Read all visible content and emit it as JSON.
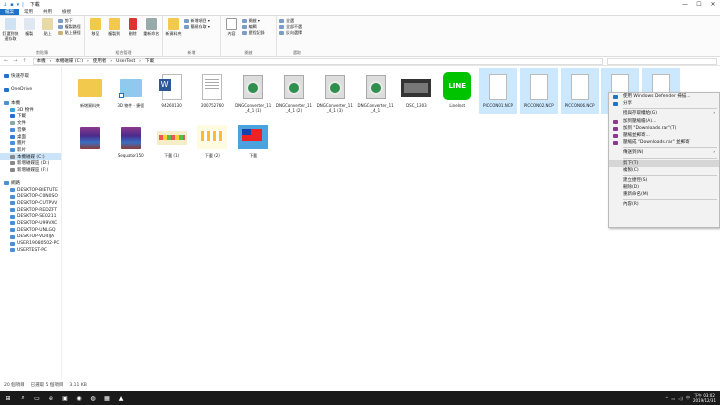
{
  "title": {
    "quick_icons": [
      "↓",
      "▪",
      "▾",
      "|"
    ],
    "path_label": "下載",
    "min": "—",
    "max": "☐",
    "close": "✕"
  },
  "tabs": [
    "檔案",
    "常用",
    "共用",
    "檢視"
  ],
  "ribbon": {
    "clipboard": {
      "label": "剪貼簿",
      "pin": "釘選到快速存取",
      "copy": "複製",
      "paste": "貼上",
      "cut": "剪下",
      "copy_path": "複製路徑",
      "paste_shortcut": "貼上捷徑"
    },
    "organize": {
      "label": "組合管理",
      "move_to": "移至",
      "copy_to": "複製到",
      "delete": "刪除",
      "rename": "重新命名"
    },
    "new": {
      "label": "新增",
      "new_folder": "新資料夾",
      "new_item": "新增項目 ▾",
      "easy_access": "簡易存取 ▾"
    },
    "open": {
      "label": "開啟",
      "properties": "內容",
      "open": "開啟 ▾",
      "edit": "編輯",
      "history": "歷程記錄"
    },
    "select": {
      "label": "選取",
      "select_all": "全選",
      "select_none": "全部不選",
      "invert": "反向選擇"
    }
  },
  "address": {
    "back": "←",
    "forward": "→",
    "up": "↑",
    "crumbs": [
      "本機",
      "›",
      "本機磁碟 (C:)",
      "›",
      "使用者",
      "›",
      "UserTest",
      "›",
      "下載"
    ]
  },
  "nav": [
    {
      "label": "快速存取",
      "color": "#1e73c8"
    },
    {
      "label": "",
      "color": ""
    },
    {
      "label": "OneDrive",
      "color": "#1e73c8"
    },
    {
      "label": "",
      "color": ""
    },
    {
      "label": "本機",
      "color": "#4a90d9"
    },
    {
      "label": "3D 物件",
      "color": "#3aa0e0"
    },
    {
      "label": "下載",
      "color": "#1e73c8"
    },
    {
      "label": "文件",
      "color": "#8aa"
    },
    {
      "label": "音樂",
      "color": "#4a90d9"
    },
    {
      "label": "桌面",
      "color": "#3a7bd5"
    },
    {
      "label": "圖片",
      "color": "#4a90d9"
    },
    {
      "label": "影片",
      "color": "#4a90d9"
    },
    {
      "label": "本機磁碟 (C:)",
      "color": "#888"
    },
    {
      "label": "新增磁碟區 (D:)",
      "color": "#888"
    },
    {
      "label": "新增磁碟區 (F:)",
      "color": "#888"
    },
    {
      "label": "",
      "color": ""
    },
    {
      "label": "網路",
      "color": "#4a90d9"
    },
    {
      "label": "DESKTOP-BIETUTE",
      "color": "#4a90d9"
    },
    {
      "label": "DESKTOP-C0N0SO",
      "color": "#4a90d9"
    },
    {
      "label": "DESKTOP-CUTPVV",
      "color": "#4a90d9"
    },
    {
      "label": "DESKTOP-REDZFT",
      "color": "#4a90d9"
    },
    {
      "label": "DESKTOP-SE0211",
      "color": "#4a90d9"
    },
    {
      "label": "DESKTOP-U99VXC",
      "color": "#4a90d9"
    },
    {
      "label": "DESKTOP-UNLGQ",
      "color": "#4a90d9"
    },
    {
      "label": "DESKTOP-VD4IJA",
      "color": "#4a90d9"
    },
    {
      "label": "USER19080502-PC",
      "color": "#4a90d9"
    },
    {
      "label": "USERTEST-PC",
      "color": "#4a90d9"
    }
  ],
  "selected_nav": "本機磁碟 (C:)",
  "files": [
    {
      "name": "新增資料夾",
      "kind": "folder",
      "selected": false
    },
    {
      "name": "3D 物件 - 捷徑",
      "kind": "shortcut",
      "selected": false
    },
    {
      "name": "94260130",
      "kind": "word",
      "selected": false
    },
    {
      "name": "200752760",
      "kind": "doc",
      "selected": false
    },
    {
      "name": "DNGConverter_11_4_1 (1)",
      "kind": "installer",
      "selected": false
    },
    {
      "name": "DNGConverter_11_4_1 (2)",
      "kind": "installer",
      "selected": false
    },
    {
      "name": "DNGConverter_11_4_1 (3)",
      "kind": "installer",
      "selected": false
    },
    {
      "name": "DNGConverter_11_4_1",
      "kind": "installer",
      "selected": false
    },
    {
      "name": "DSC_1303",
      "kind": "photo",
      "selected": false
    },
    {
      "name": "LineInst",
      "kind": "line",
      "selected": false
    },
    {
      "name": "PICCON01.NCP",
      "kind": "blank",
      "selected": true
    },
    {
      "name": "PICCON02.NCP",
      "kind": "blank",
      "selected": true
    },
    {
      "name": "PICCON06.NCP",
      "kind": "blank",
      "selected": true
    },
    {
      "name": "PIC",
      "kind": "blank",
      "selected": true
    },
    {
      "name": "",
      "kind": "blank",
      "selected": true
    },
    {
      "name": "",
      "kind": "rar",
      "selected": false
    },
    {
      "name": "Sequator150",
      "kind": "rar",
      "selected": false
    },
    {
      "name": "下載 (1)",
      "kind": "strip",
      "selected": false
    },
    {
      "name": "下載 (2)",
      "kind": "yellow",
      "selected": false
    },
    {
      "name": "下載",
      "kind": "flag",
      "selected": false
    }
  ],
  "context_menu": [
    {
      "label": "使用 Windows Defender 掃描...",
      "icon": "#1e73c8",
      "arrow": ""
    },
    {
      "label": "分享",
      "icon": "#1e73c8",
      "arrow": ""
    },
    {
      "sep": true
    },
    {
      "label": "授與存取權給(G)",
      "icon": "",
      "arrow": "›"
    },
    {
      "label": "加到壓縮檔(A)...",
      "icon": "#8b3a8b",
      "arrow": ""
    },
    {
      "label": "加到 \"Downloads.rar\"(T)",
      "icon": "#8b3a8b",
      "arrow": ""
    },
    {
      "label": "壓縮並郵寄...",
      "icon": "#8b3a8b",
      "arrow": ""
    },
    {
      "label": "壓縮成 \"Downloads.rar\" 並郵寄",
      "icon": "#8b3a8b",
      "arrow": ""
    },
    {
      "sep": true
    },
    {
      "label": "傳送到(N)",
      "icon": "",
      "arrow": "›"
    },
    {
      "sep": true
    },
    {
      "label": "剪下(T)",
      "icon": "",
      "arrow": "",
      "hl": true
    },
    {
      "label": "複製(C)",
      "icon": "",
      "arrow": ""
    },
    {
      "sep": true
    },
    {
      "label": "建立捷徑(S)",
      "icon": "",
      "arrow": ""
    },
    {
      "label": "刪除(D)",
      "icon": "",
      "arrow": ""
    },
    {
      "label": "重新命名(M)",
      "icon": "",
      "arrow": ""
    },
    {
      "sep": true
    },
    {
      "label": "內容(R)",
      "icon": "",
      "arrow": ""
    }
  ],
  "status": {
    "count": "20 個項目",
    "selected": "已選取 5 個項目",
    "size": "3.11 KB"
  },
  "taskbar": {
    "apps": [
      "⊞",
      "⌕",
      "▭",
      "e",
      "▣",
      "◉",
      "◍",
      "▦",
      "▲"
    ],
    "tray": [
      "^",
      "▭",
      "◁)",
      "中"
    ],
    "time": "下午 03:02",
    "date": "2019/12/31"
  }
}
